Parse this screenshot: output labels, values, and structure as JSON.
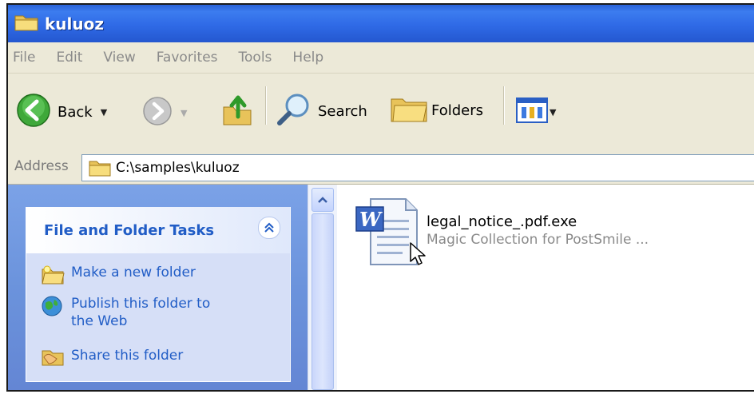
{
  "window": {
    "title": "kuluoz"
  },
  "menu": [
    "File",
    "Edit",
    "View",
    "Favorites",
    "Tools",
    "Help"
  ],
  "toolbar": {
    "back_label": "Back",
    "search_label": "Search",
    "folders_label": "Folders"
  },
  "address": {
    "label": "Address",
    "path": "C:\\samples\\kuluoz"
  },
  "tasks_panel": {
    "title": "File and Folder Tasks",
    "items": [
      {
        "label": "Make a new folder",
        "icon": "new-folder-icon"
      },
      {
        "label": "Publish this folder to the Web",
        "icon": "publish-web-icon"
      },
      {
        "label": "Share this folder",
        "icon": "share-folder-icon"
      }
    ]
  },
  "files": [
    {
      "name": "legal_notice_.pdf.exe",
      "description": "Magic Collection for PostSmile ...",
      "icon": "word-document-icon"
    }
  ],
  "colors": {
    "titlebar": "#2f6ae6",
    "task_link": "#215dc6",
    "left_pane": "#6b93dc"
  }
}
